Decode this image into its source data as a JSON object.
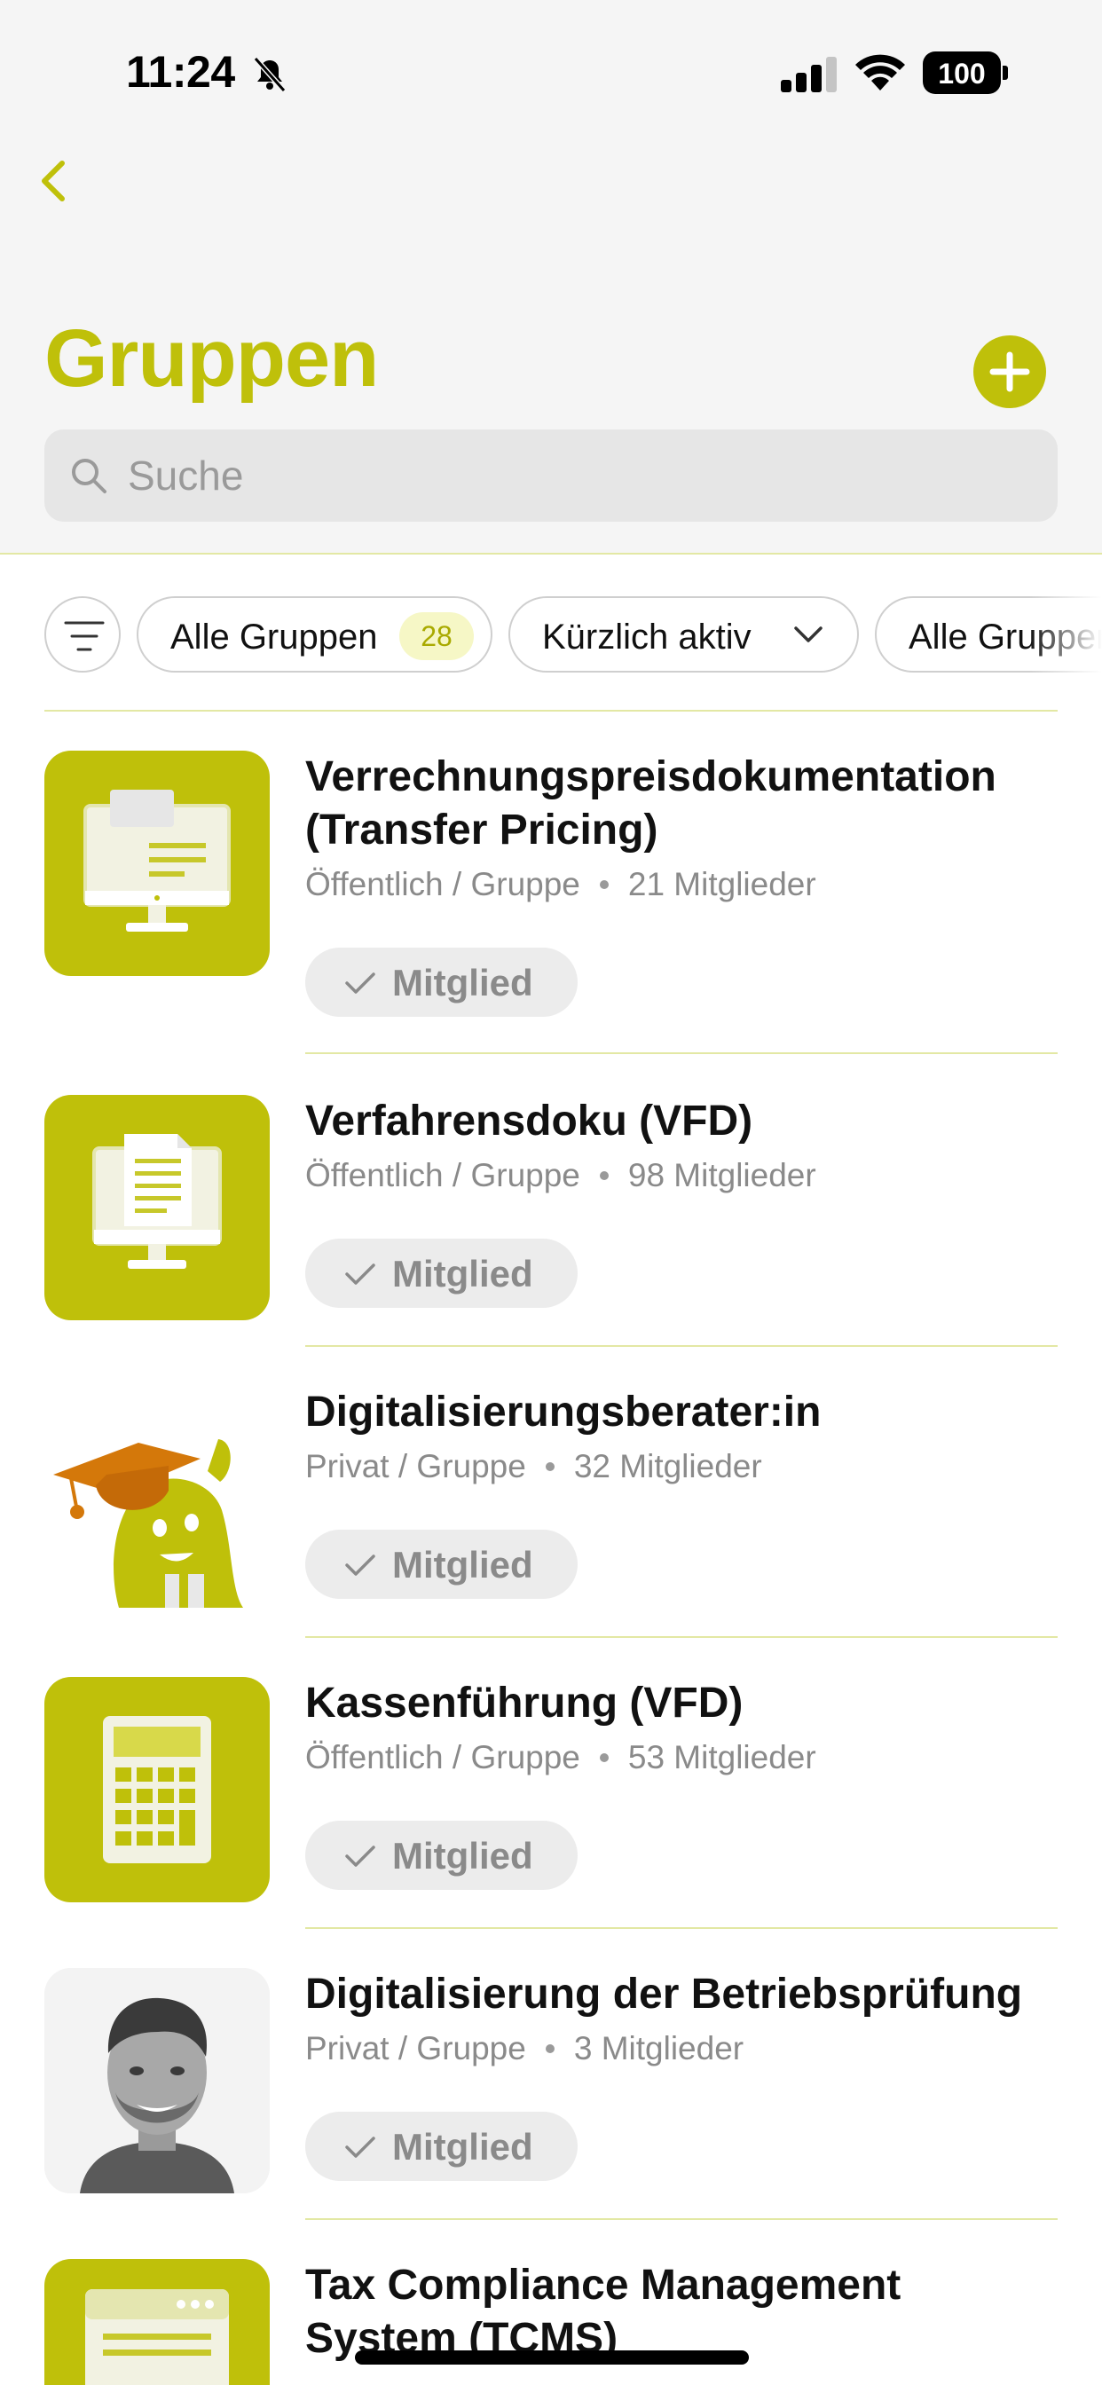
{
  "status_bar": {
    "time": "11:24",
    "battery": "100"
  },
  "header": {
    "title": "Gruppen"
  },
  "search": {
    "placeholder": "Suche"
  },
  "filters": {
    "all_groups": {
      "label": "Alle Gruppen",
      "count": "28"
    },
    "sort": {
      "label": "Kürzlich aktiv"
    },
    "type": {
      "label": "Alle Gruppen"
    }
  },
  "groups": [
    {
      "name": "Verrechnungspreisdokumentation (Transfer Pricing)",
      "visibility": "Öffentlich / Gruppe",
      "members": "21 Mitglieder",
      "status": "Mitglied",
      "icon": "monitor-document-icon"
    },
    {
      "name": "Verfahrensdoku (VFD)",
      "visibility": "Öffentlich / Gruppe",
      "members": "98 Mitglieder",
      "status": "Mitglied",
      "icon": "monitor-file-icon"
    },
    {
      "name": "Digitalisierungsberater:in",
      "visibility": "Privat / Gruppe",
      "members": "32 Mitglieder",
      "status": "Mitglied",
      "icon": "graduate-mascot-icon"
    },
    {
      "name": "Kassenführung (VFD)",
      "visibility": "Öffentlich / Gruppe",
      "members": "53 Mitglieder",
      "status": "Mitglied",
      "icon": "calculator-icon"
    },
    {
      "name": "Digitalisierung der Betriebsprüfung",
      "visibility": "Privat / Gruppe",
      "members": "3 Mitglieder",
      "status": "Mitglied",
      "icon": "person-portrait"
    },
    {
      "name": "Tax Compliance Management System (TCMS)",
      "icon": "browser-window-icon"
    }
  ],
  "colors": {
    "accent": "#bfc00a",
    "divider": "#e3e8a4",
    "muted": "#8a8a8a",
    "chip_bg": "#ececec"
  }
}
